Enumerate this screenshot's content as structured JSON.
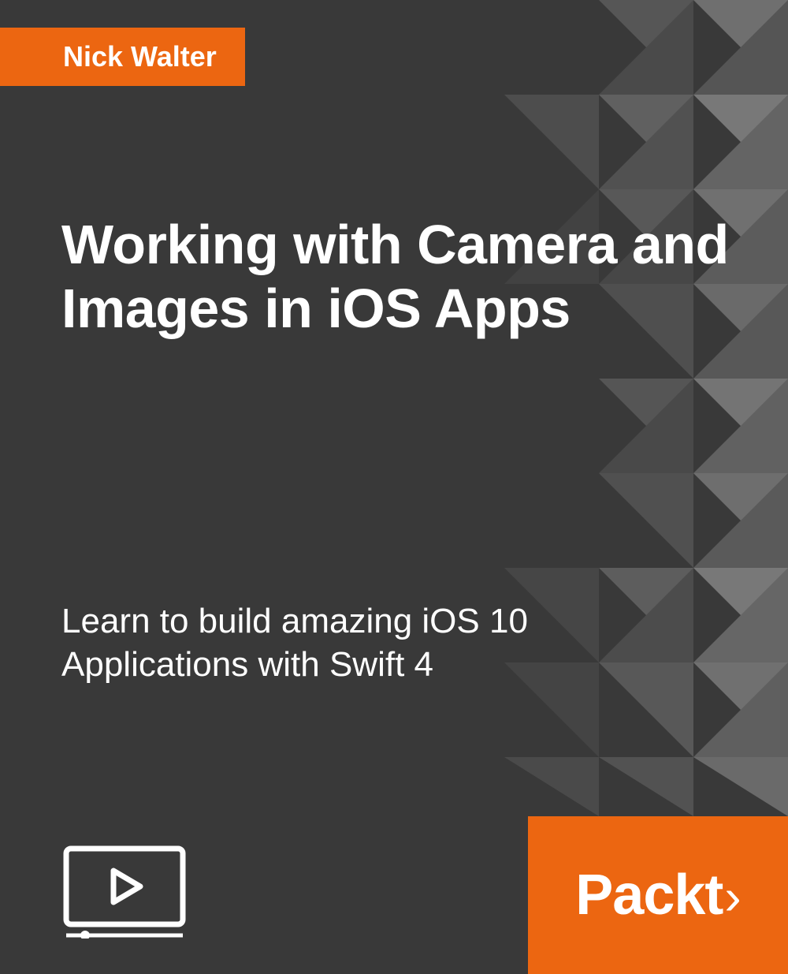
{
  "author": "Nick Walter",
  "title": "Working with Camera and Images in iOS Apps",
  "subtitle": "Learn to build amazing iOS 10 Applications with Swift 4",
  "publisher": "Packt",
  "colors": {
    "background": "#393939",
    "accent": "#ec6611",
    "text": "#ffffff"
  },
  "icons": {
    "video": "video-play-icon",
    "publisher_angle": "›"
  }
}
